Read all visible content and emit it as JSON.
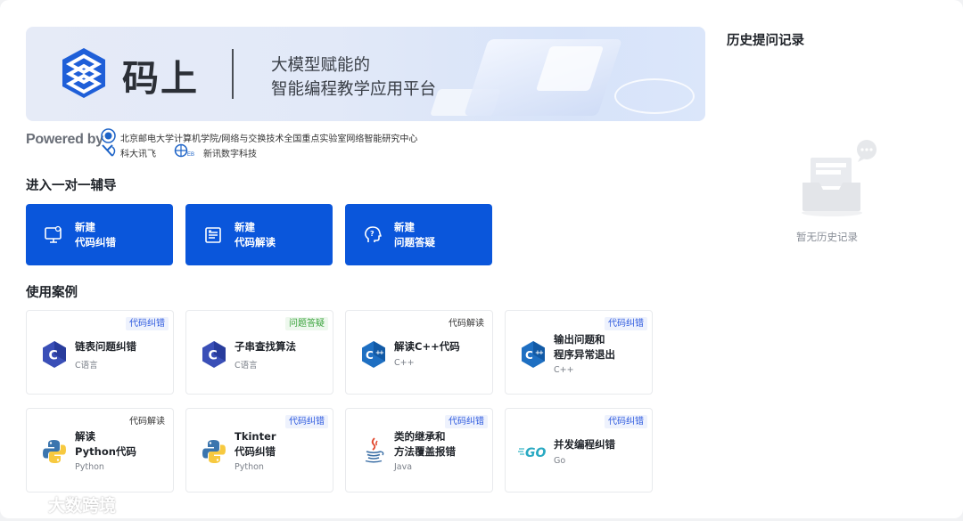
{
  "banner": {
    "logo_text": "码上",
    "slogan_line1": "大模型赋能的",
    "slogan_line2": "智能编程教学应用平台"
  },
  "powered": {
    "label": "Powered by",
    "org1": "北京邮电大学计算机学院/网络与交换技术全国重点实验室网络智能研究中心",
    "org2": "科大讯飞",
    "org3": "新讯数字科技"
  },
  "tutoring": {
    "title": "进入一对一辅导",
    "buttons": [
      {
        "line1": "新建",
        "line2": "代码纠错",
        "icon": "monitor-icon"
      },
      {
        "line1": "新建",
        "line2": "代码解读",
        "icon": "document-icon"
      },
      {
        "line1": "新建",
        "line2": "问题答疑",
        "icon": "question-head-icon"
      }
    ]
  },
  "cases": {
    "title": "使用案例",
    "items": [
      {
        "tag": "代码纠错",
        "title1": "链表问题纠错",
        "title2": "",
        "sub": "C语言",
        "icon": "c-language-icon"
      },
      {
        "tag": "问题答疑",
        "title1": "子串查找算法",
        "title2": "",
        "sub": "C语言",
        "icon": "c-language-icon"
      },
      {
        "tag": "代码解读",
        "title1": "解读C++代码",
        "title2": "",
        "sub": "C++",
        "icon": "cpp-icon"
      },
      {
        "tag": "代码纠错",
        "title1": "输出问题和",
        "title2": "程序异常退出",
        "sub": "C++",
        "icon": "cpp-icon"
      },
      {
        "tag": "代码解读",
        "title1": "解读",
        "title2": "Python代码",
        "sub": "Python",
        "icon": "python-icon"
      },
      {
        "tag": "代码纠错",
        "title1": "Tkinter",
        "title2": "代码纠错",
        "sub": "Python",
        "icon": "python-icon"
      },
      {
        "tag": "代码纠错",
        "title1": "类的继承和",
        "title2": "方法覆盖报错",
        "sub": "Java",
        "icon": "java-icon"
      },
      {
        "tag": "代码纠错",
        "title1": "并发编程纠错",
        "title2": "",
        "sub": "Go",
        "icon": "go-icon"
      }
    ]
  },
  "history": {
    "title": "历史提问记录",
    "empty_text": "暂无历史记录"
  },
  "watermark": {
    "text": "大数跨境"
  },
  "colors": {
    "primary": "#0a56db",
    "tag_blue": "#2f5bdf",
    "tag_green": "#3aa33c"
  }
}
